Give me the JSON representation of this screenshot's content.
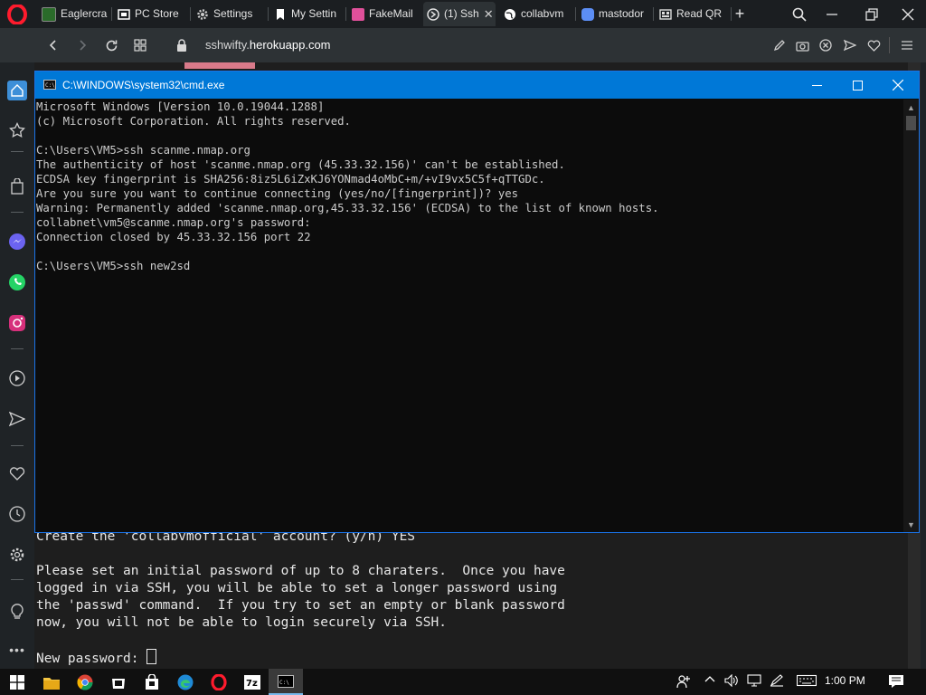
{
  "browser": {
    "tabs": [
      {
        "label": "Eaglercra",
        "icon": "eaglercraft-icon",
        "color": "#2a6b2a"
      },
      {
        "label": "PC Store",
        "icon": "store-icon",
        "color": "#ffffff"
      },
      {
        "label": "Settings",
        "icon": "gear-icon",
        "color": "#cccccc"
      },
      {
        "label": "My Settin",
        "icon": "bookmark-icon",
        "color": "#ffffff"
      },
      {
        "label": "FakeMail",
        "icon": "fakemail-icon",
        "color": "#e0509a"
      },
      {
        "label": "(1) Ssh",
        "icon": "ssh-icon",
        "color": "#e0e0e0"
      },
      {
        "label": "collabvm",
        "icon": "globe-icon",
        "color": "#ffffff"
      },
      {
        "label": "mastodor",
        "icon": "mastodon-icon",
        "color": "#5c8ef5"
      },
      {
        "label": "Read QR",
        "icon": "qr-icon",
        "color": "#dddddd"
      }
    ],
    "active_tab_close": "✕",
    "new_tab": "+",
    "url_prefix": "sshwifty.",
    "url_domain": "herokuapp.com"
  },
  "cmd": {
    "title": "C:\\WINDOWS\\system32\\cmd.exe",
    "lines": [
      "Microsoft Windows [Version 10.0.19044.1288]",
      "(c) Microsoft Corporation. All rights reserved.",
      "",
      "C:\\Users\\VM5>ssh scanme.nmap.org",
      "The authenticity of host 'scanme.nmap.org (45.33.32.156)' can't be established.",
      "ECDSA key fingerprint is SHA256:8iz5L6iZxKJ6YONmad4oMbC+m/+vI9vx5C5f+qTTGDc.",
      "Are you sure you want to continue connecting (yes/no/[fingerprint])? yes",
      "Warning: Permanently added 'scanme.nmap.org,45.33.32.156' (ECDSA) to the list of known hosts.",
      "collabnet\\vm5@scanme.nmap.org's password:",
      "Connection closed by 45.33.32.156 port 22",
      "",
      "C:\\Users\\VM5>ssh new2sd"
    ]
  },
  "webterm": {
    "lines": [
      "Create the 'collabvmofficial' account? (y/n) YES",
      "",
      "Please set an initial password of up to 8 charaters.  Once you have",
      "logged in via SSH, you will be able to set a longer password using",
      "the 'passwd' command.  If you try to set an empty or blank password",
      "now, you will not be able to login securely via SSH.",
      "",
      "New password: "
    ]
  },
  "taskbar": {
    "time": "1:00 PM",
    "apps": [
      "file-explorer-icon",
      "chrome-icon",
      "store-icon",
      "shopping-bag-icon",
      "edge-icon",
      "opera-icon",
      "7zip-icon",
      "cmd-icon"
    ]
  },
  "colors": {
    "accent": "#0078d7",
    "opera_red": "#ff1b2d"
  }
}
